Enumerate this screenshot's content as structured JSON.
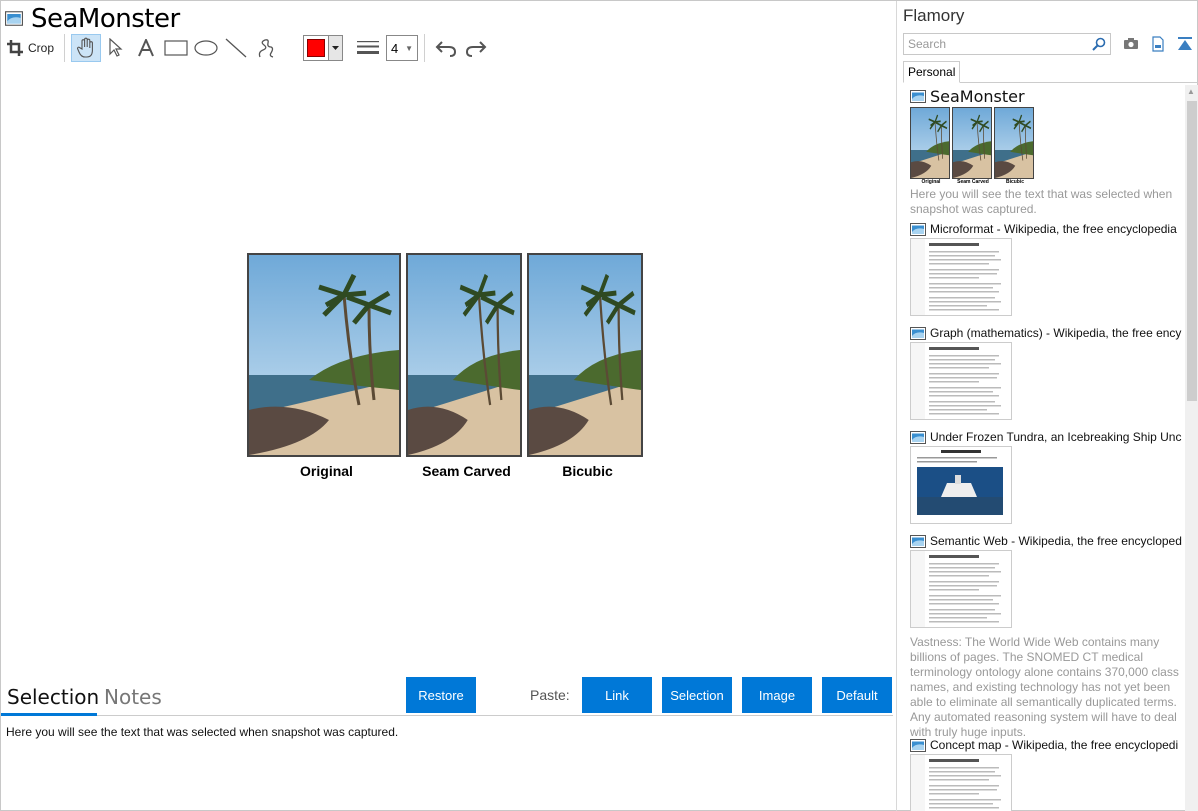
{
  "editor": {
    "title": "SeaMonster",
    "toolbar": {
      "crop_label": "Crop",
      "line_size": "4",
      "color": "#ff0000",
      "tools": [
        "pan-hand-icon",
        "pointer-icon",
        "text-icon",
        "rectangle-icon",
        "ellipse-icon",
        "line-icon",
        "freehand-icon"
      ],
      "undo_icon": "undo-icon",
      "redo_icon": "redo-icon"
    },
    "figure": {
      "captions": [
        "Original",
        "Seam Carved",
        "Bicubic"
      ]
    },
    "bottom": {
      "tabs": [
        "Selection",
        "Notes"
      ],
      "active_tab": "Selection",
      "restore_label": "Restore",
      "paste_label": "Paste:",
      "paste_buttons": [
        "Link",
        "Selection",
        "Image",
        "Default"
      ],
      "selection_text": "Here you will see the text that was selected when snapshot was captured."
    }
  },
  "sidebar": {
    "title": "Flamory",
    "search_placeholder": "Search",
    "tabs": [
      "Personal"
    ],
    "items": [
      {
        "title": "SeaMonster",
        "mini_captions": [
          "Original",
          "Seam Carved",
          "Bicubic"
        ],
        "desc": "Here you will see the text that was selected when snapshot was captured."
      },
      {
        "title": "Microformat - Wikipedia, the free encyclopedia"
      },
      {
        "title": "Graph (mathematics) - Wikipedia, the free ency"
      },
      {
        "title": "Under Frozen Tundra, an Icebreaking Ship Unco"
      },
      {
        "title": "Semantic Web - Wikipedia, the free encycloped",
        "desc": "Vastness: The World Wide Web contains many billions of pages. The SNOMED CT medical terminology ontology alone contains 370,000 class names, and existing technology has not yet been able to eliminate all semantically duplicated terms. Any automated reasoning system will have to deal with truly huge inputs."
      },
      {
        "title": "Concept map - Wikipedia, the free encyclopedi"
      }
    ]
  }
}
